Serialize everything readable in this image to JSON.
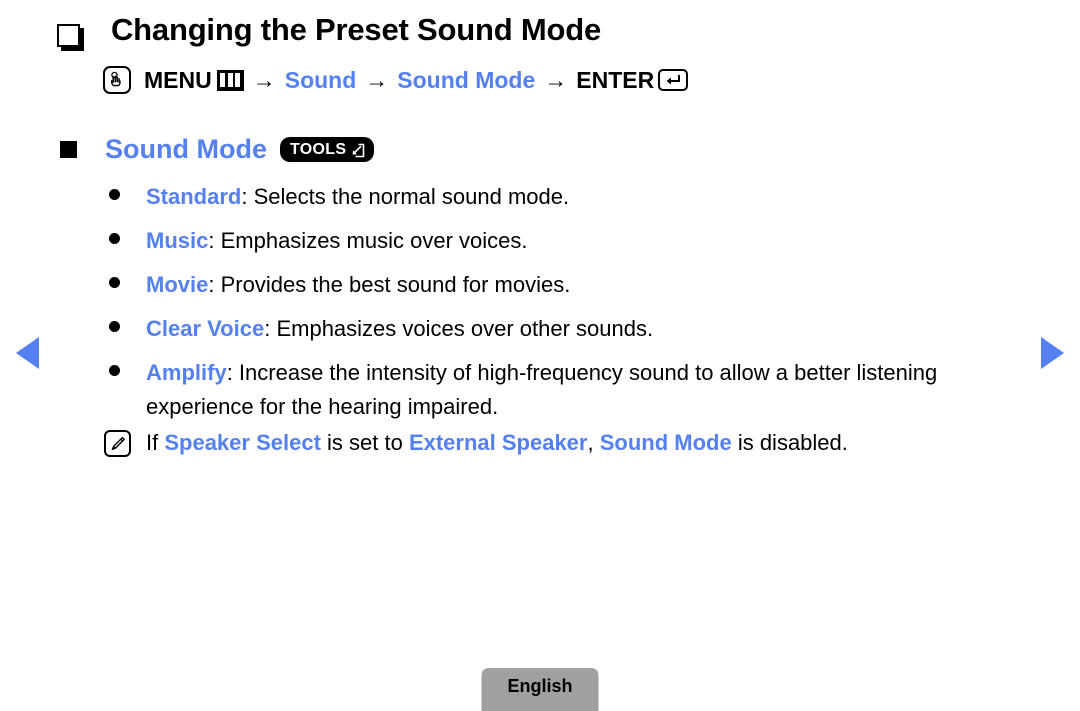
{
  "title": {
    "text": "Changing the Preset Sound Mode"
  },
  "menu_path": {
    "pointer_icon": "hand-pointer-icon",
    "menu_label": "MENU",
    "menu_icon": "menu-grid-icon",
    "arrow": "→",
    "step1": "Sound",
    "step2": "Sound Mode",
    "enter_label": "ENTER",
    "enter_icon": "enter-return-icon"
  },
  "section": {
    "heading": "Sound Mode",
    "badge_label": "TOOLS",
    "badge_icon": "tools-arrow-icon"
  },
  "modes": [
    {
      "name": "Standard",
      "separator": ": ",
      "description": "Selects the normal sound mode."
    },
    {
      "name": "Music",
      "separator": ": ",
      "description": "Emphasizes music over voices."
    },
    {
      "name": "Movie",
      "separator": ": ",
      "description": "Provides the best sound for movies."
    },
    {
      "name": "Clear Voice",
      "separator": ": ",
      "description": "Emphasizes voices over other sounds."
    },
    {
      "name": "Amplify",
      "separator": ": ",
      "description": "Increase the intensity of high-frequency sound to allow a better listening experience for the hearing impaired."
    }
  ],
  "note": {
    "icon": "note-pencil-icon",
    "prefix": "If ",
    "term1": "Speaker Select",
    "mid1": " is set to ",
    "term2": "External Speaker",
    "mid2": ", ",
    "term3": "Sound Mode",
    "suffix": " is disabled."
  },
  "navigation": {
    "prev_icon": "previous-page-arrow",
    "next_icon": "next-page-arrow"
  },
  "footer": {
    "language": "English"
  },
  "colors": {
    "accent_blue": "#5580f0",
    "text_black": "#000000",
    "background": "#ffffff",
    "tab_gray": "#a0a0a0"
  }
}
